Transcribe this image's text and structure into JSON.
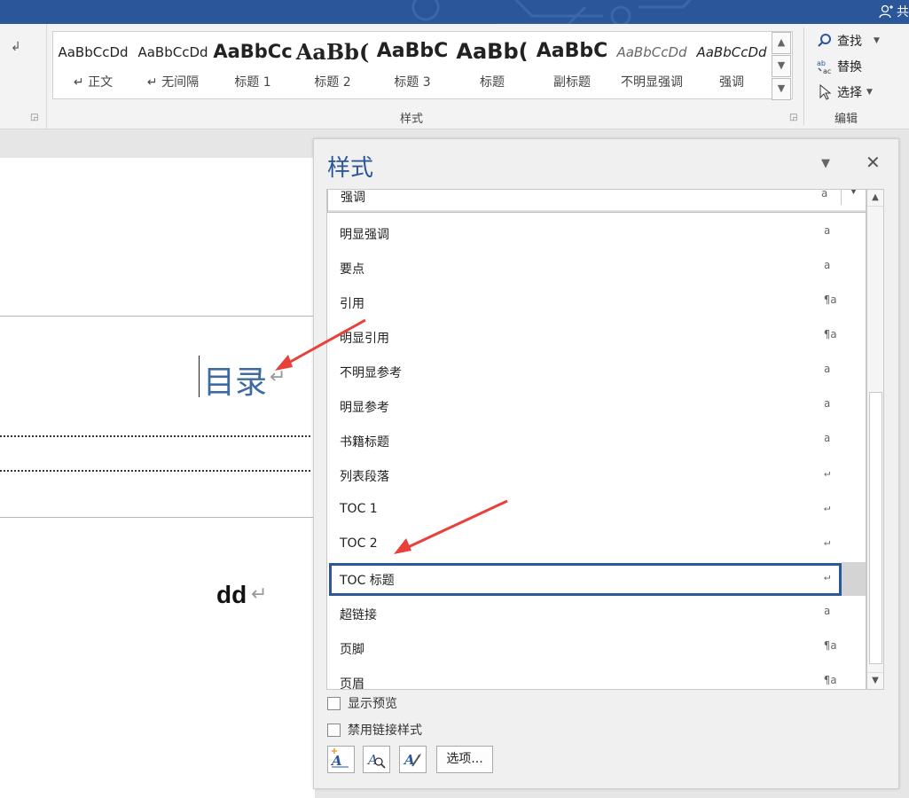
{
  "titlebar": {
    "share_label": "共"
  },
  "ribbon": {
    "styles_group_label": "样式",
    "edit_group_label": "编辑",
    "style_gallery": [
      {
        "preview": "AaBbCcDd",
        "name": "↵ 正文"
      },
      {
        "preview": "AaBbCcDd",
        "name": "↵ 无间隔"
      },
      {
        "preview": "AaBbCc",
        "name": "标题 1"
      },
      {
        "preview": "AaBb(",
        "name": "标题 2"
      },
      {
        "preview": "AaBbC",
        "name": "标题 3"
      },
      {
        "preview": "AaBb(",
        "name": "标题"
      },
      {
        "preview": "AaBbC",
        "name": "副标题"
      },
      {
        "preview": "AaBbCcDd",
        "name": "不明显强调"
      },
      {
        "preview": "AaBbCcDd",
        "name": "强调"
      }
    ],
    "editing": {
      "find_label": "查找",
      "replace_label": "替换",
      "select_label": "选择"
    }
  },
  "document": {
    "toc_heading": "目录",
    "paragraph_mark": "↵",
    "body_text": "dd"
  },
  "styles_pane": {
    "title": "样式",
    "close_label": "✕",
    "items": [
      {
        "label": "强调",
        "type": "a"
      },
      {
        "label": "明显强调",
        "type": "a"
      },
      {
        "label": "要点",
        "type": "a"
      },
      {
        "label": "引用",
        "type": "¶a"
      },
      {
        "label": "明显引用",
        "type": "¶a"
      },
      {
        "label": "不明显参考",
        "type": "a"
      },
      {
        "label": "明显参考",
        "type": "a"
      },
      {
        "label": "书籍标题",
        "type": "a"
      },
      {
        "label": "列表段落",
        "type": "↵"
      },
      {
        "label": "TOC 1",
        "type": "↵"
      },
      {
        "label": "TOC 2",
        "type": "↵"
      },
      {
        "label": "TOC 标题",
        "type": "↵"
      },
      {
        "label": "超链接",
        "type": "a"
      },
      {
        "label": "页脚",
        "type": "¶a"
      },
      {
        "label": "页眉",
        "type": "¶a"
      }
    ],
    "selected_item": "TOC 标题",
    "show_preview_label": "显示预览",
    "disable_linked_label": "禁用链接样式",
    "options_button_label": "选项..."
  },
  "colors": {
    "accent": "#2b579a",
    "annotation_arrow": "#e8403a",
    "heading_text": "#3d6aa2"
  }
}
